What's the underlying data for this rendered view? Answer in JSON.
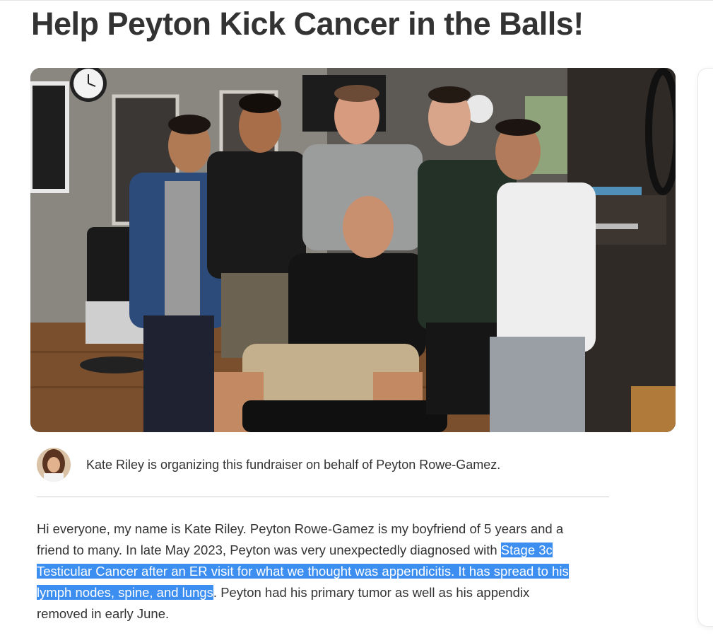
{
  "campaign": {
    "title": "Help Peyton Kick Cancer in the Balls!"
  },
  "hero": {
    "alt": "Group photo of six young men in a barbershop"
  },
  "organizer": {
    "text": "Kate Riley is organizing this fundraiser on behalf of Peyton Rowe-Gamez."
  },
  "story": {
    "line1": "Hi everyone, my name is Kate Riley. Peyton Rowe-Gamez is my boyfriend of 5 years and a",
    "line2_plain": "friend to many. In late May 2023, Peyton was very unexpectedly diagnosed with ",
    "line2_highlight": "Stage 3c",
    "line3_highlight": "Testicular Cancer after an ER visit for what we thought was appendicitis. It has spread to his",
    "line4_highlight": "lymph nodes, spine, and lungs",
    "line4_plain": ". Peyton had his primary tumor as well as his appendix",
    "line5": "removed in early June."
  },
  "colors": {
    "highlight": "#3c8ef0",
    "text": "#333333",
    "divider": "#cfcfcf"
  }
}
